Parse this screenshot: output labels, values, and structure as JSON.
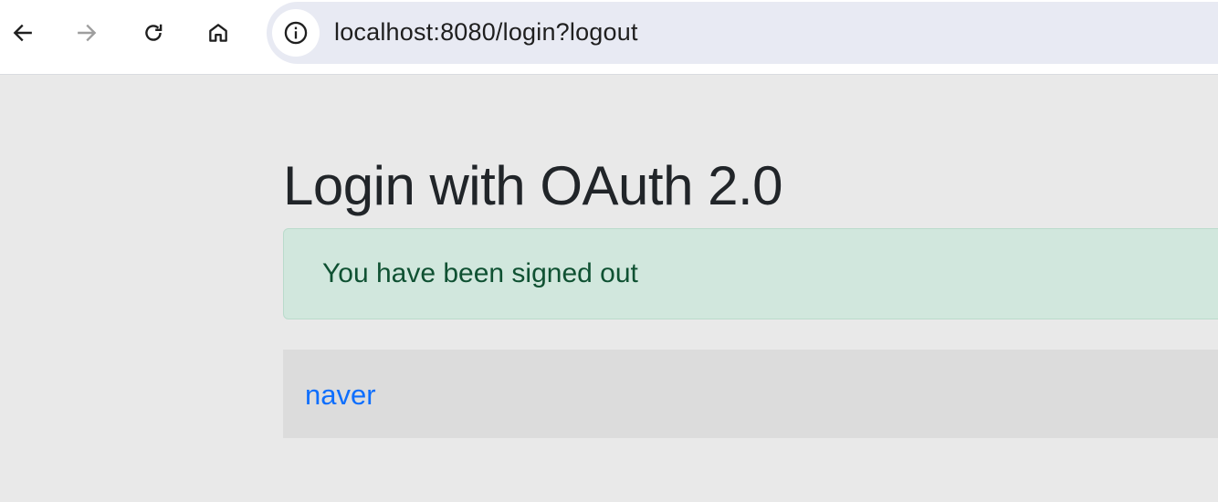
{
  "browser": {
    "url": "localhost:8080/login?logout",
    "buttons": {
      "back": "arrow-left-icon",
      "forward": "arrow-right-icon",
      "reload": "reload-icon",
      "home": "home-icon",
      "site_info": "info-icon"
    },
    "forward_disabled": true
  },
  "page": {
    "heading": "Login with OAuth 2.0",
    "alert": {
      "text": "You have been signed out",
      "color": "#0f5132",
      "background": "#d1e7dd"
    },
    "providers": [
      {
        "label": "naver"
      }
    ],
    "link_color": "#0d6efd"
  }
}
